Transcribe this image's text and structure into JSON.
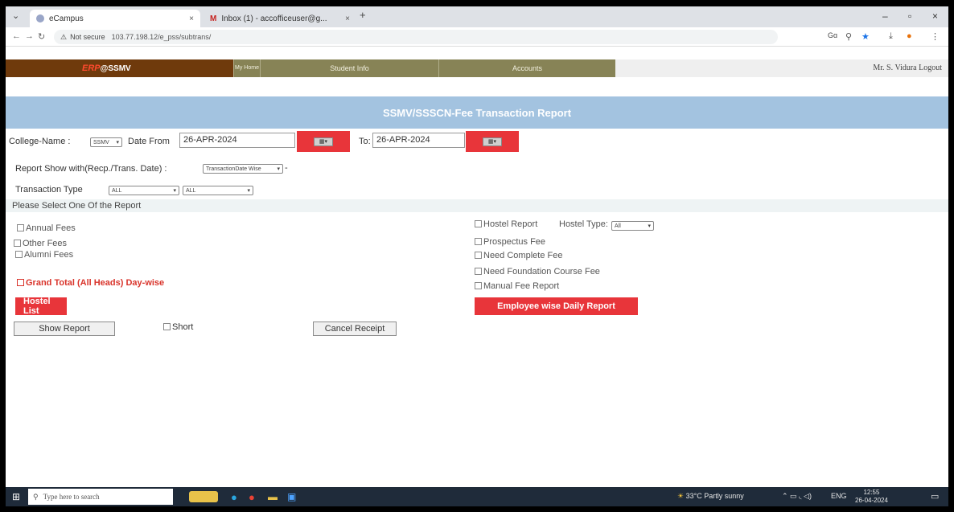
{
  "browser": {
    "tabs": [
      {
        "label": "eCampus",
        "active": true
      },
      {
        "label": "Inbox (1) - accofficeuser@g...",
        "active": false
      }
    ],
    "new_tab": "+",
    "close_glyph": "×",
    "security": "Not secure",
    "url": "103.77.198.12/e_pss/subtrans/"
  },
  "header": {
    "brand_erp": "ERP",
    "brand_name": "@SSMV",
    "nav": [
      "My Home",
      "Student Info",
      "Accounts"
    ],
    "user": "Mr. S. Vidura",
    "logout": "Logout"
  },
  "report": {
    "title": "SSMV/SSSCN-Fee Transaction  Report",
    "college_label": "College-Name :",
    "college_value": "SSMV",
    "date_from_label": "Date From",
    "date_from": "26-APR-2024",
    "to_label": "To",
    "date_to": "26-APR-2024",
    "report_show_label": "Report Show with(Recp./Trans. Date) :",
    "report_show_value": "TransactionDate Wise",
    "transaction_type_label": "Transaction Type",
    "transaction_type_1": "ALL",
    "transaction_type_2": "ALL",
    "select_one_label": "Please Select One Of the Report",
    "left_options": [
      "Annual Fees",
      "Other Fees",
      "Alumni Fees"
    ],
    "grand_total": "Grand Total (All Heads) Day-wise",
    "right_options": [
      "Hostel Report",
      "Prospectus Fee",
      "Need Complete Fee",
      "Need Foundation Course Fee",
      "Manual Fee Report"
    ],
    "hostel_type_label": "Hostel Type:",
    "hostel_type_value": "All",
    "hostel_list": "Hostel List",
    "employee_report": "Employee wise Daily Report",
    "show_report": "Show Report",
    "short": "Short",
    "cancel_receipt": "Cancel Receipt"
  },
  "taskbar": {
    "search_placeholder": "Type here to search",
    "weather": "33°C  Partly sunny",
    "lang": "ENG",
    "time": "12:55",
    "date": "26-04-2024"
  },
  "colors": {
    "brown": "#6f3a0c",
    "olive": "#878356",
    "title_blue": "#a3c3e0",
    "red": "#e8353a",
    "taskbar": "#1f2b3a"
  }
}
